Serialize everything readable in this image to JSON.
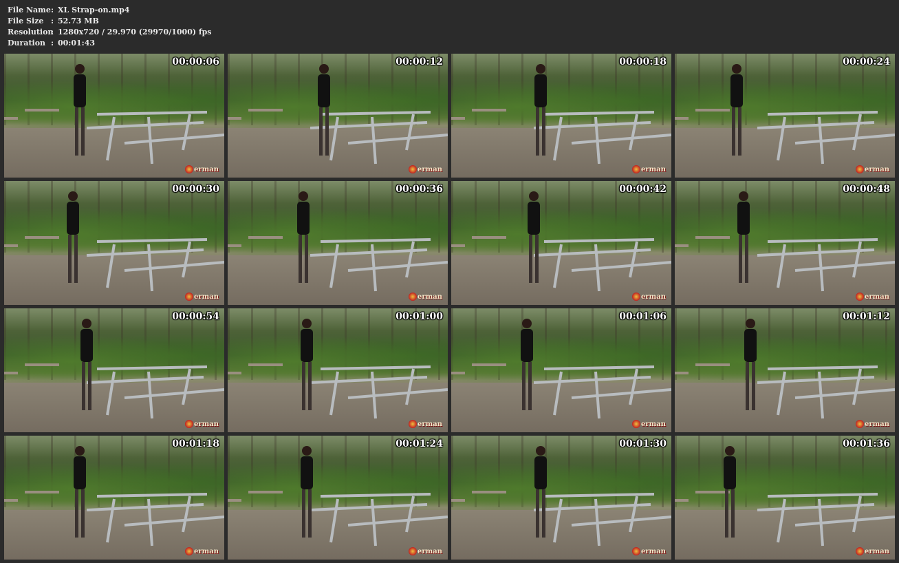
{
  "file_info": {
    "rows": [
      {
        "key": "File Name",
        "value": "XL Strap-on.mp4"
      },
      {
        "key": "File Size",
        "value": "52.73 MB"
      },
      {
        "key": "Resolution",
        "value": "1280x720 / 29.970 (29970/1000) fps"
      },
      {
        "key": "Duration",
        "value": "00:01:43"
      }
    ],
    "separator": ":"
  },
  "thumbnails": [
    {
      "time": "00:00:06"
    },
    {
      "time": "00:00:12"
    },
    {
      "time": "00:00:18"
    },
    {
      "time": "00:00:24"
    },
    {
      "time": "00:00:30"
    },
    {
      "time": "00:00:36"
    },
    {
      "time": "00:00:42"
    },
    {
      "time": "00:00:48"
    },
    {
      "time": "00:00:54"
    },
    {
      "time": "00:01:00"
    },
    {
      "time": "00:01:06"
    },
    {
      "time": "00:01:12"
    },
    {
      "time": "00:01:18"
    },
    {
      "time": "00:01:24"
    },
    {
      "time": "00:01:30"
    },
    {
      "time": "00:01:36"
    }
  ],
  "watermark": {
    "text": "erman",
    "icon": "seal-icon"
  },
  "colors": {
    "background": "#2b2b2b",
    "text": "#e8e8e8",
    "timestamp": "#ffffff"
  }
}
